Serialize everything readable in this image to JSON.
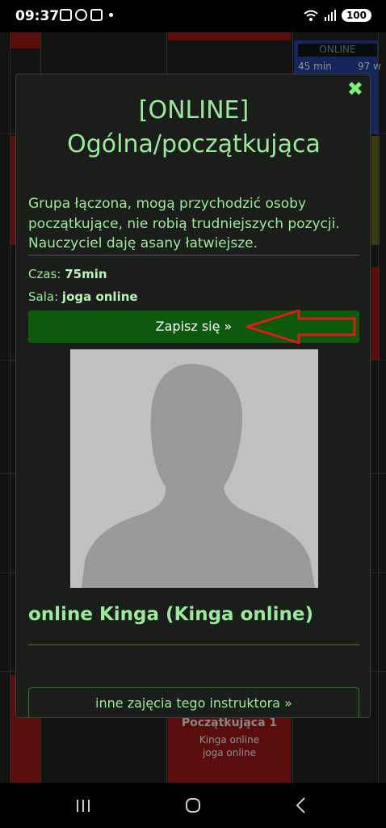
{
  "status_bar": {
    "time": "09:37",
    "battery": "100"
  },
  "background": {
    "top_card_tag": "ONLINE",
    "top_card_left": "45 min",
    "top_card_right": "97 w",
    "bottom_card_title": "Początkująca 1",
    "bottom_card_teacher": "Kinga online",
    "bottom_card_room": "joga online"
  },
  "modal": {
    "title_line1": "[ONLINE]",
    "title_line2": "Ogólna/początkująca",
    "description": "Grupa łączona, mogą przychodzić osoby początkujące, nie robią trudniejszych pozycji. Nauczyciel daję asany łatwiejsze.",
    "duration_label": "Czas:",
    "duration_value": "75min",
    "room_label": "Sala:",
    "room_value": "joga online",
    "signup_button": "Zapisz się »",
    "instructor_name": "online Kinga (Kinga online)",
    "other_classes_button": "inne zajęcia tego instruktora »"
  },
  "colors": {
    "accent_green": "#9bea9b",
    "button_green": "#0d5a0d",
    "annotation_red": "#e01a1a"
  },
  "icons": {
    "close": "close-icon",
    "arrow": "red-arrow-annotation",
    "nav_recent": "recent-apps-icon",
    "nav_home": "home-icon",
    "nav_back": "back-icon"
  }
}
